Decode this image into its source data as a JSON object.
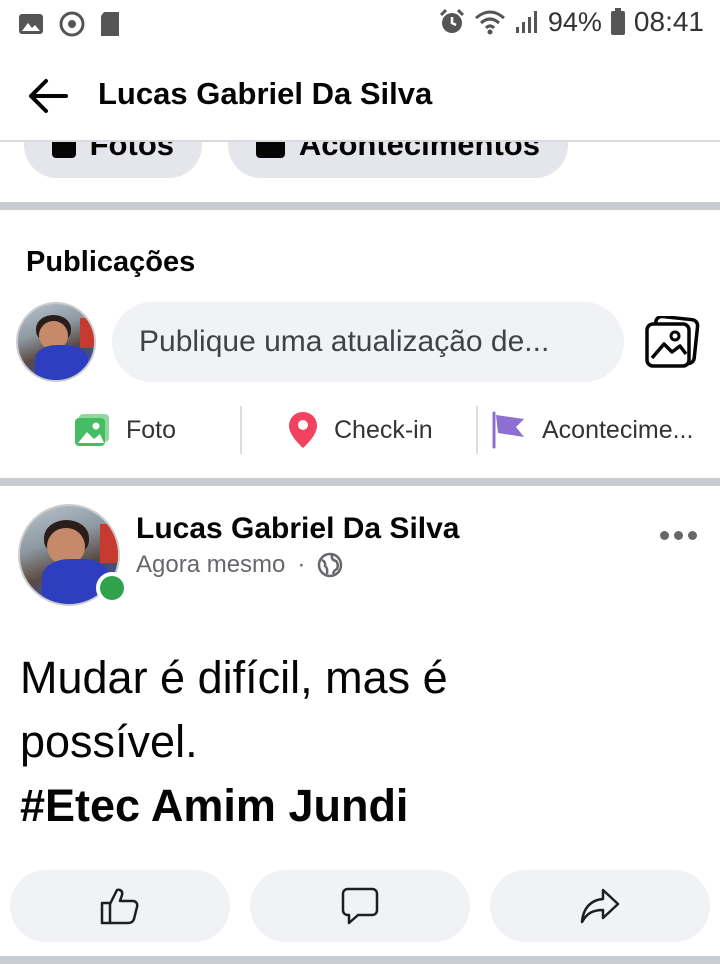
{
  "status_bar": {
    "battery": "94%",
    "time": "08:41",
    "left_icons": [
      "gallery-icon",
      "sync-icon",
      "sd-card-icon"
    ],
    "right_icons": [
      "alarm-icon",
      "wifi-icon",
      "signal-icon",
      "battery-icon"
    ]
  },
  "header": {
    "title": "Lucas Gabriel Da Silva",
    "back_icon": "back-arrow-icon"
  },
  "chips": [
    {
      "label": "Fotos"
    },
    {
      "label": "Acontecimentos"
    }
  ],
  "publicacoes": {
    "title": "Publicações",
    "composer_placeholder": "Publique uma atualização de...",
    "actions": [
      {
        "label": "Foto",
        "icon": "photo-icon",
        "color": "#45bd62"
      },
      {
        "label": "Check-in",
        "icon": "location-pin-icon",
        "color": "#f3425f"
      },
      {
        "label": "Acontecime...",
        "icon": "flag-icon",
        "color": "#8c6fd0"
      }
    ]
  },
  "post": {
    "author": "Lucas Gabriel Da Silva",
    "time": "Agora mesmo",
    "separator": "·",
    "privacy_icon": "globe-icon",
    "text_line1": "Mudar é difícil, mas é",
    "text_line2": "possível.",
    "hashtag": "#Etec Amim Jundi",
    "online_color": "#31a24c",
    "buttons": [
      "like-icon",
      "comment-icon",
      "share-icon"
    ]
  }
}
